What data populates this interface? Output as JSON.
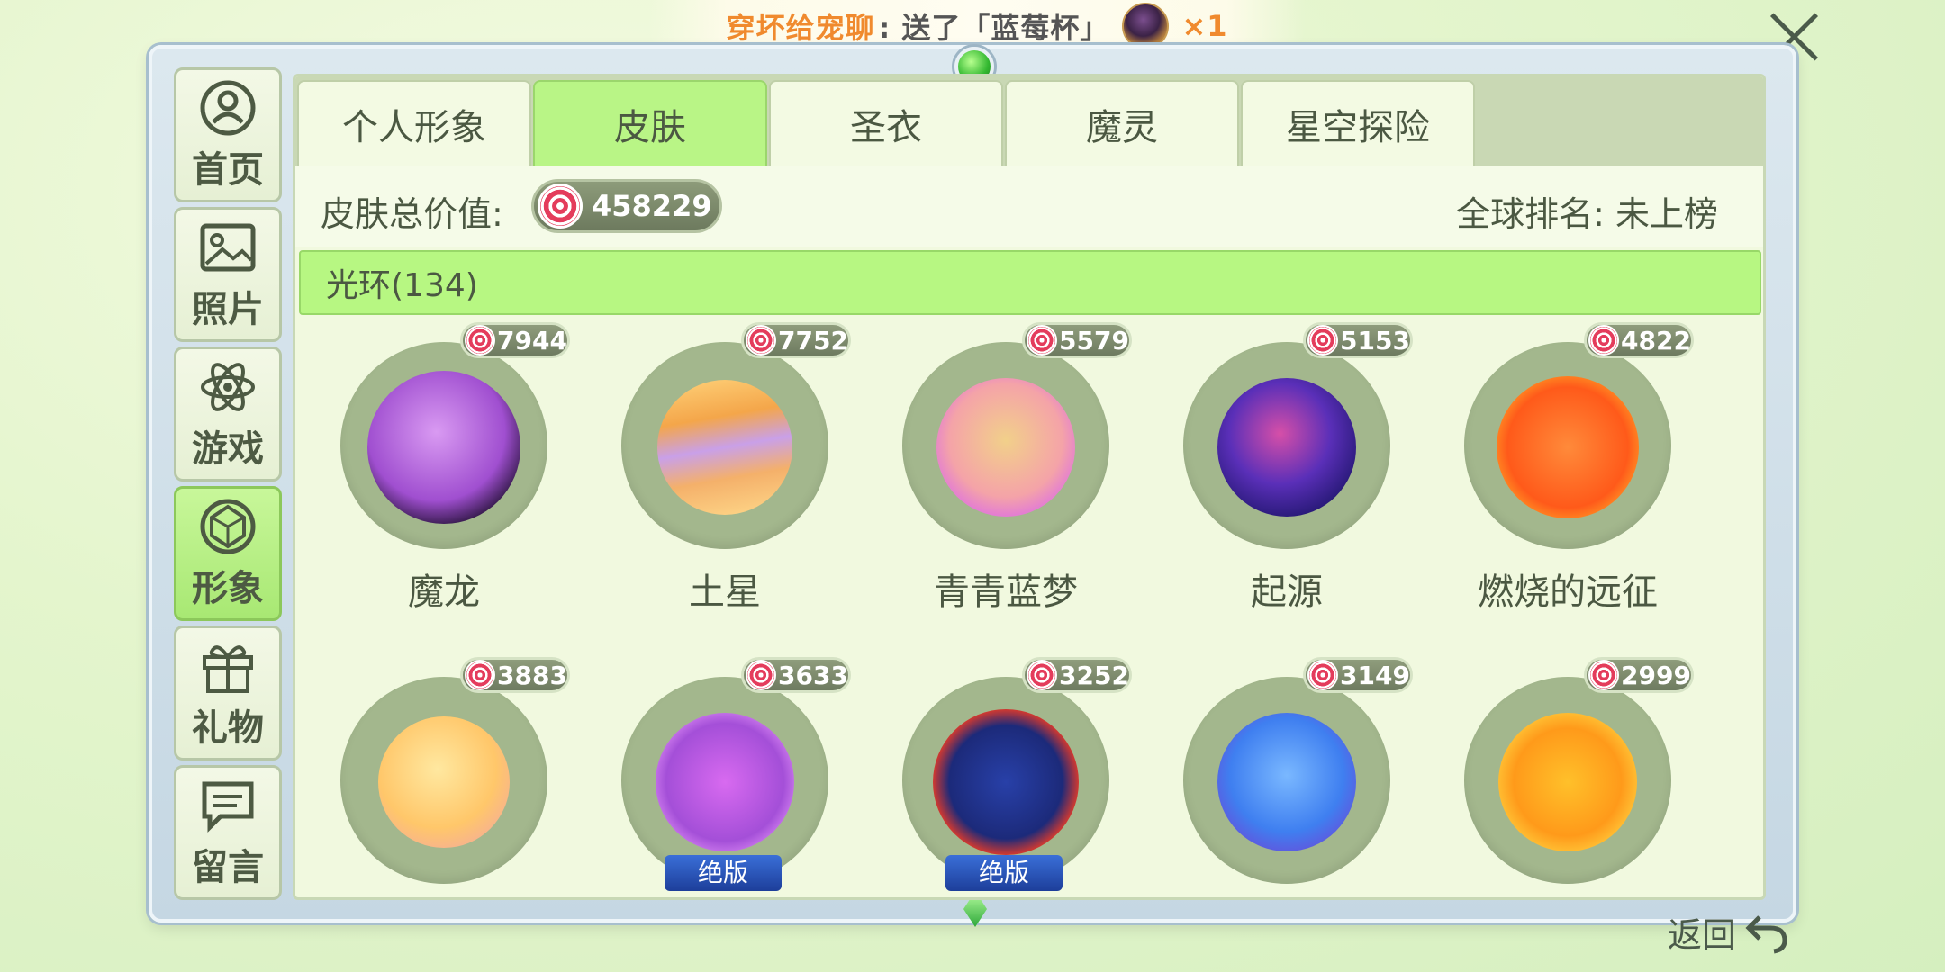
{
  "notification": {
    "sender": "穿坏给宠聊",
    "message": ":  送了「蓝莓杯」",
    "count": "×1"
  },
  "sidebar": {
    "items": [
      {
        "label": "首页",
        "icon": "home-icon"
      },
      {
        "label": "照片",
        "icon": "photo-icon"
      },
      {
        "label": "游戏",
        "icon": "atom-icon"
      },
      {
        "label": "形象",
        "icon": "gem-icon",
        "active": true
      },
      {
        "label": "礼物",
        "icon": "gift-icon"
      },
      {
        "label": "留言",
        "icon": "message-icon"
      }
    ]
  },
  "tabs": [
    {
      "label": "个人形象"
    },
    {
      "label": "皮肤",
      "active": true
    },
    {
      "label": "圣衣"
    },
    {
      "label": "魔灵"
    },
    {
      "label": "星空探险"
    }
  ],
  "stats": {
    "total_label": "皮肤总价值:",
    "total_value": "458229",
    "rank_text": "全球排名: 未上榜"
  },
  "category": {
    "label": "光环(134)"
  },
  "items": [
    {
      "name": "魔龙",
      "price": "7944",
      "orb_color": "#b04fd8"
    },
    {
      "name": "土星",
      "price": "7752",
      "orb_color": "#f2b04a"
    },
    {
      "name": "青青蓝梦",
      "price": "5579",
      "orb_color": "#f6b7a0"
    },
    {
      "name": "起源",
      "price": "5153",
      "orb_color": "#5b2fb0"
    },
    {
      "name": "燃烧的远征",
      "price": "4822",
      "orb_color": "#ff5a1a"
    },
    {
      "name": "",
      "price": "3883",
      "orb_color": "#ffc76a"
    },
    {
      "name": "",
      "price": "3633",
      "orb_color": "#c24fe0",
      "tag": "绝版"
    },
    {
      "name": "",
      "price": "3252",
      "orb_color": "#2840a8",
      "tag": "绝版"
    },
    {
      "name": "",
      "price": "3149",
      "orb_color": "#3f7ff0"
    },
    {
      "name": "",
      "price": "2999",
      "orb_color": "#ffa51a"
    }
  ],
  "footer": {
    "back_label": "返回"
  },
  "colors": {
    "accent_green": "#b7f782",
    "panel_bg": "#f1f9df",
    "price_badge": "#7a876a",
    "coin_red": "#e43c5c"
  }
}
